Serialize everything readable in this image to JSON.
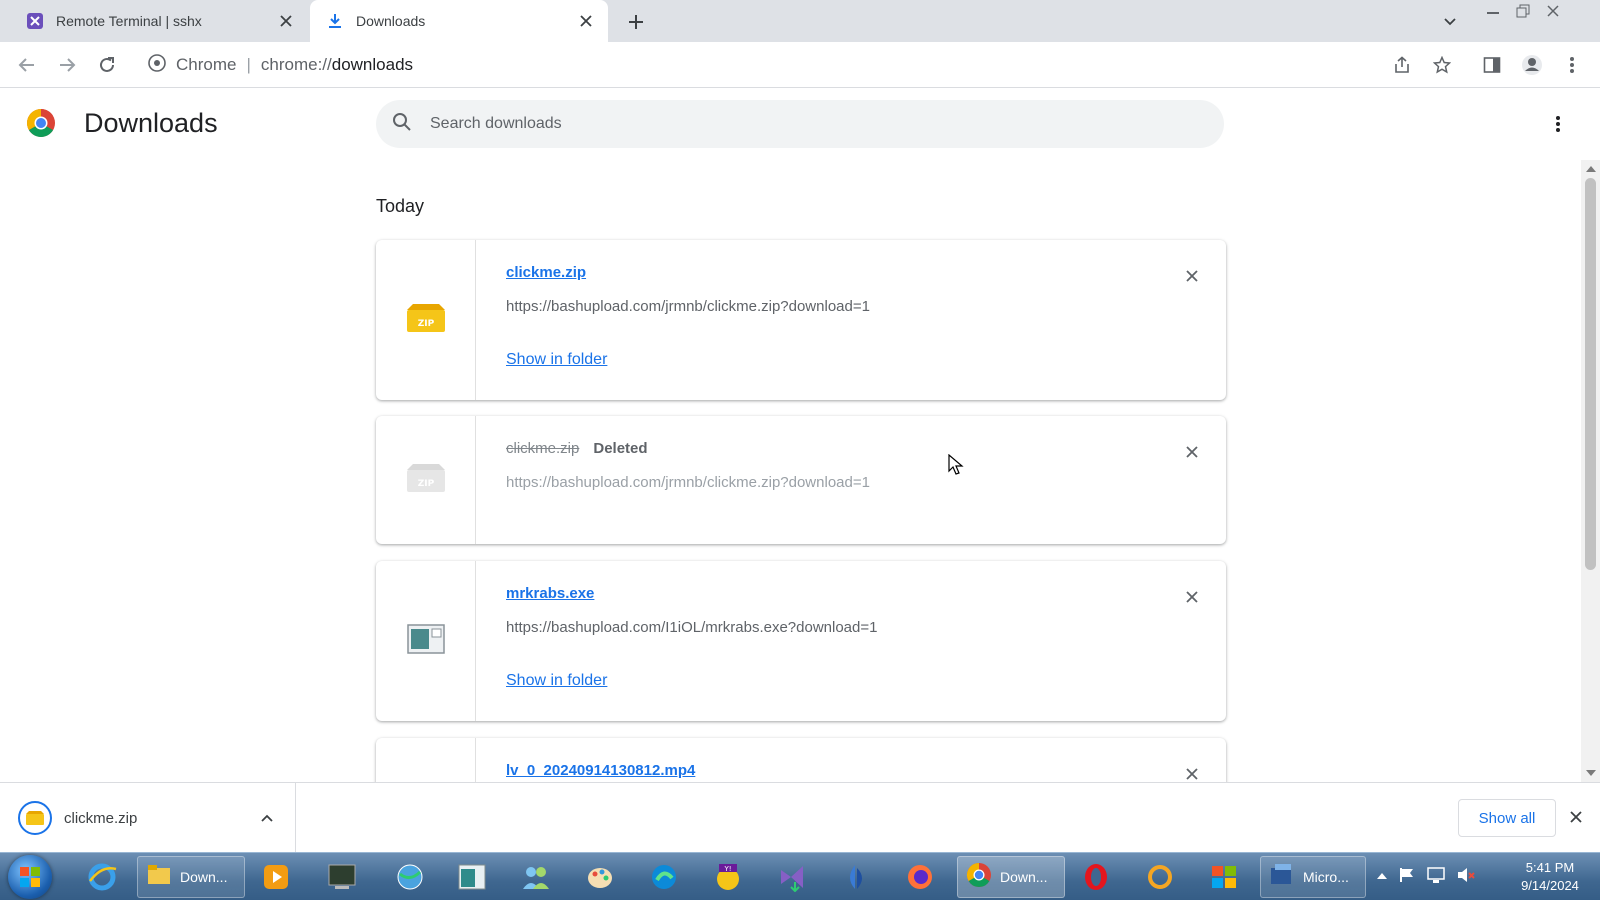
{
  "browser": {
    "tabs": [
      {
        "title": "Remote Terminal | sshx",
        "favicon": "sshx-icon",
        "active": false
      },
      {
        "title": "Downloads",
        "favicon": "download-icon",
        "active": true
      }
    ],
    "omnibox": {
      "site_label": "Chrome",
      "url_scheme": "chrome://",
      "url_host": "downloads"
    }
  },
  "page": {
    "title": "Downloads",
    "search_placeholder": "Search downloads",
    "section": "Today"
  },
  "downloads": [
    {
      "file_name": "clickme.zip",
      "url": "https://bashupload.com/jrmnb/clickme.zip?download=1",
      "status": "",
      "action": "Show in folder",
      "icon": "zip-icon",
      "deleted": false
    },
    {
      "file_name": "clickme.zip",
      "url": "https://bashupload.com/jrmnb/clickme.zip?download=1",
      "status": "Deleted",
      "action": "",
      "icon": "zip-icon",
      "deleted": true
    },
    {
      "file_name": "mrkrabs.exe",
      "url": "https://bashupload.com/I1iOL/mrkrabs.exe?download=1",
      "status": "",
      "action": "Show in folder",
      "icon": "exe-icon",
      "deleted": false
    },
    {
      "file_name": "lv_0_20240914130812.mp4",
      "url": "",
      "status": "",
      "action": "",
      "icon": "video-icon",
      "deleted": false
    }
  ],
  "shelf": {
    "item_name": "clickme.zip",
    "show_all": "Show all"
  },
  "taskbar": {
    "items": [
      {
        "label": "Down...",
        "icon": "file-explorer-icon"
      },
      {
        "label": "Down...",
        "icon": "chrome-icon"
      },
      {
        "label": "Micro...",
        "icon": "app-icon"
      }
    ],
    "time": "5:41 PM",
    "date": "9/14/2024"
  },
  "colors": {
    "accent": "#1a73e8",
    "tabstrip": "#dee1e6",
    "taskbar": "#3f6790"
  }
}
